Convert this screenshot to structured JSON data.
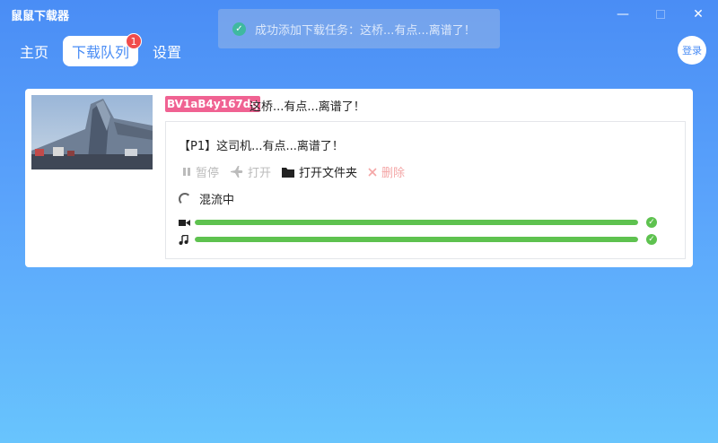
{
  "app": {
    "title": "鼠鼠下载器"
  },
  "window": {
    "minimize": "—",
    "maximize": "",
    "close": "✕"
  },
  "toast": {
    "message": "成功添加下载任务：这桥...有点...离谱了！",
    "icon": "check-icon"
  },
  "nav": {
    "tabs": [
      {
        "label": "主页",
        "active": false
      },
      {
        "label": "下载队列",
        "active": true,
        "badge": "1"
      },
      {
        "label": "设置",
        "active": false
      }
    ],
    "login": "登录"
  },
  "task": {
    "bvid": "BV1aB4y167dq",
    "title": "这桥...有点...离谱了！",
    "part": {
      "title": "【P1】这司机...有点...离谱了！",
      "actions": {
        "pause": "暂停",
        "open": "打开",
        "open_folder": "打开文件夹",
        "delete": "删除"
      },
      "status": "混流中",
      "video_progress": 100,
      "audio_progress": 100
    }
  },
  "colors": {
    "accent": "#4a8df5",
    "bvid_tag": "#f06292",
    "progress": "#5ec24f",
    "badge": "#f04c4c"
  }
}
